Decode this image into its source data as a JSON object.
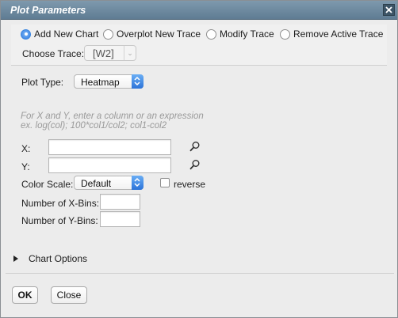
{
  "dialog": {
    "title": "Plot Parameters"
  },
  "modes": [
    {
      "label": "Add New Chart",
      "checked": true
    },
    {
      "label": "Overplot New Trace",
      "checked": false
    },
    {
      "label": "Modify Trace",
      "checked": false
    },
    {
      "label": "Remove Active Trace",
      "checked": false
    }
  ],
  "trace": {
    "label": "Choose Trace:",
    "value": "[W2]"
  },
  "plot_type": {
    "label": "Plot Type:",
    "value": "Heatmap"
  },
  "hint": {
    "line1": "For X and Y, enter a column or an expression",
    "line2": "ex. log(col); 100*col1/col2; col1-col2"
  },
  "x_field": {
    "label": "X:",
    "value": ""
  },
  "y_field": {
    "label": "Y:",
    "value": ""
  },
  "color_scale": {
    "label": "Color Scale:",
    "value": "Default",
    "reverse_label": "reverse",
    "reverse_checked": false
  },
  "x_bins": {
    "label": "Number of X-Bins:",
    "value": ""
  },
  "y_bins": {
    "label": "Number of Y-Bins:",
    "value": ""
  },
  "chart_options": {
    "label": "Chart Options"
  },
  "buttons": {
    "ok": "OK",
    "close": "Close"
  }
}
